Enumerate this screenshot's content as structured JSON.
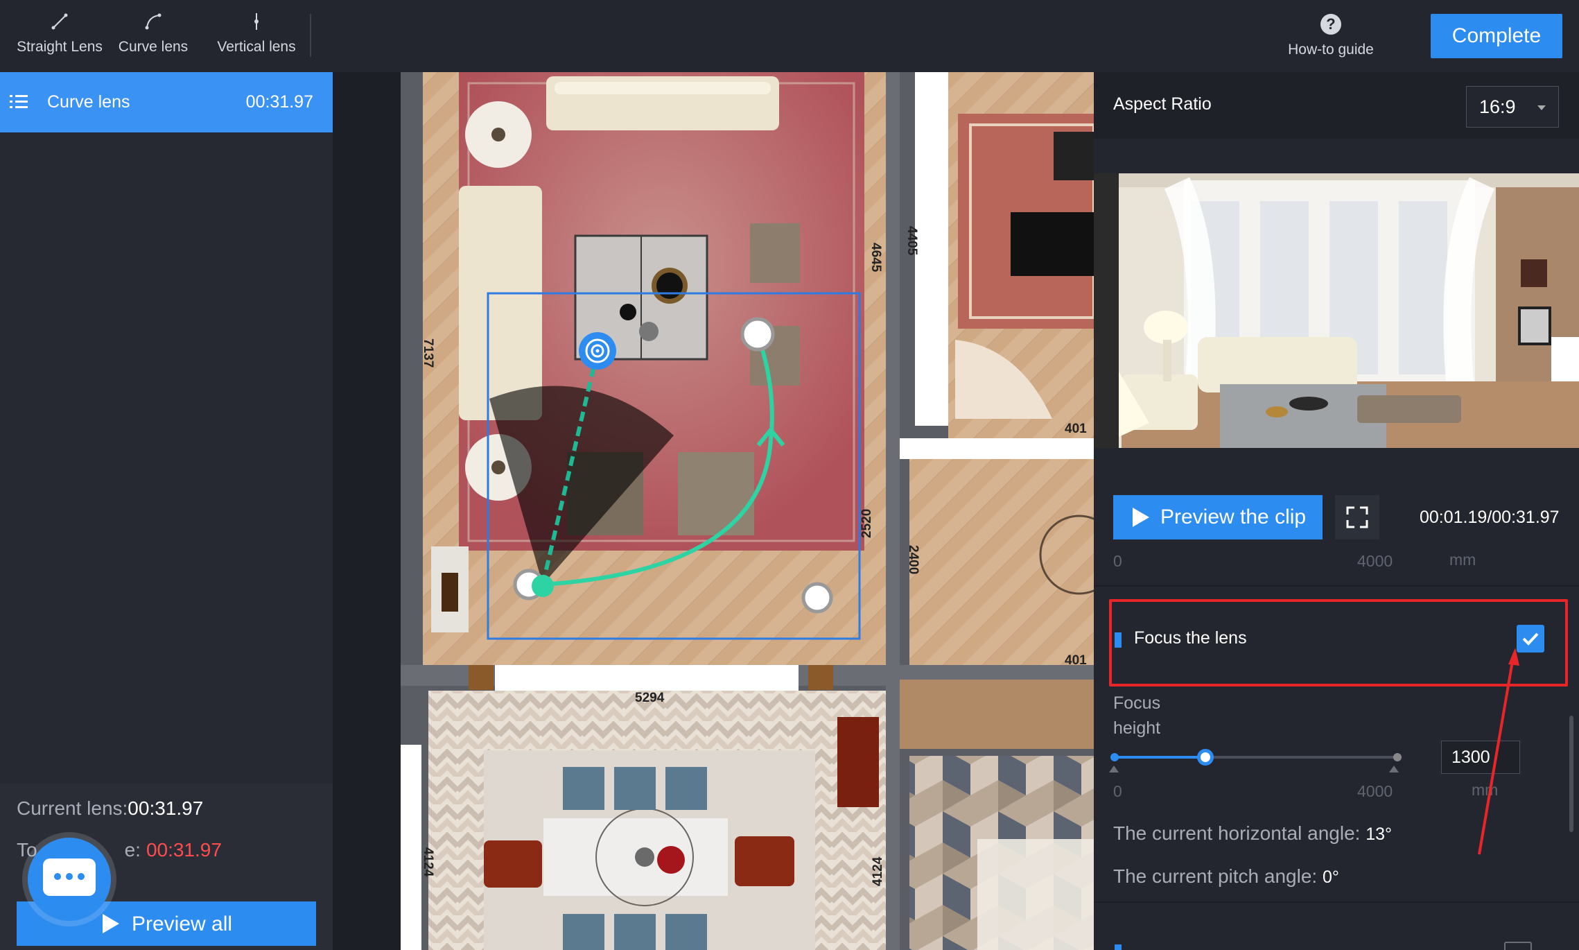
{
  "toolbar": {
    "tools": [
      {
        "label": "Straight Lens",
        "icon": "straight-lens-icon"
      },
      {
        "label": "Curve lens",
        "icon": "curve-lens-icon"
      },
      {
        "label": "Vertical lens",
        "icon": "vertical-lens-icon"
      }
    ],
    "howto_label": "How-to guide",
    "complete_label": "Complete"
  },
  "lens_list": {
    "items": [
      {
        "name": "Curve lens",
        "time": "00:31.97"
      }
    ]
  },
  "summary": {
    "current_lens_label": "Current lens:",
    "current_lens_value": "00:31.97",
    "total_prefix": "To",
    "total_suffix": "e:",
    "total_value": "00:31.97",
    "preview_all_label": "Preview all"
  },
  "floorplan": {
    "dimensions": [
      "4645",
      "4405",
      "7137",
      "2520",
      "2400",
      "5294",
      "4124",
      "4124",
      "401",
      "401"
    ]
  },
  "settings": {
    "aspect_label": "Aspect Ratio",
    "aspect_value": "16:9",
    "preview_clip_label": "Preview the clip",
    "clip_time": "00:01.19/00:31.97",
    "scale_min": "0",
    "scale_max": "4000",
    "unit": "mm",
    "focus_label": "Focus the lens",
    "focus_checked": true,
    "focus_height_label_1": "Focus",
    "focus_height_label_2": "height",
    "focus_height_value": "1300",
    "focus_height_fraction": 0.325,
    "horizontal_angle_label": "The current horizontal angle: ",
    "horizontal_angle_value": "13°",
    "pitch_angle_label": "The current pitch angle: ",
    "pitch_angle_value": "0°"
  },
  "colors": {
    "accent": "#2d8cf0",
    "highlight": "#e8262a",
    "path": "#2ed3a3"
  }
}
